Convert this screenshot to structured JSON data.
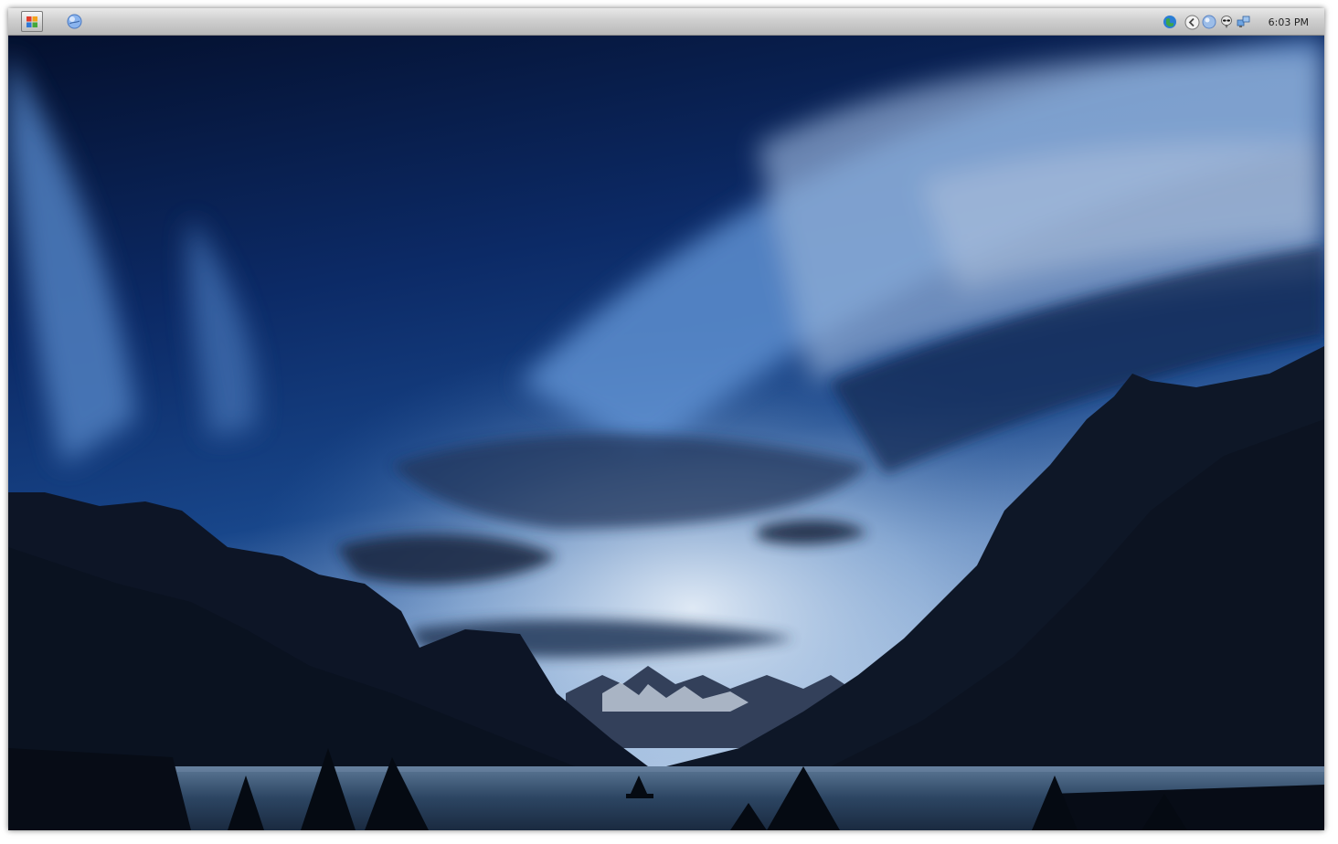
{
  "taskbar": {
    "start_icon": "start-menu-grid-icon",
    "launcher_icon": "browser-globe-icon",
    "tray_icons": [
      "network-globe-icon",
      "tray-collapse-arrow-icon",
      "moon-globe-icon",
      "alien-icon",
      "network-computers-icon"
    ],
    "clock": "6:03 PM"
  },
  "wallpaper": {
    "subject": "mountain-lake-dusk-wallpaper",
    "colors": {
      "sky_top": "#06123a",
      "sky_mid": "#123a7a",
      "sky_light": "#8fb4de",
      "horizon": "#dfe9f5",
      "mountain": "#0b1322",
      "lake": "#2f4a66"
    }
  }
}
